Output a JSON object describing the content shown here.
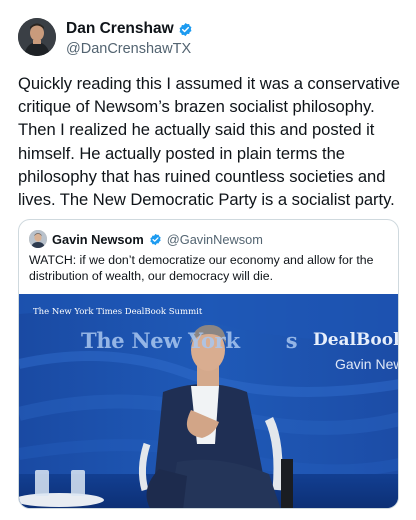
{
  "author": {
    "name": "Dan Crenshaw",
    "handle": "@DanCrenshawTX",
    "verified": true
  },
  "tweet": {
    "text": "Quickly reading this I assumed it was a conservative critique of Newsom’s brazen socialist philosophy. Then I realized he actually said this and posted it himself. He actually posted in plain terms the philosophy that has ruined countless societies and lives. The New Democratic Party is a socialist party."
  },
  "quote": {
    "author_name": "Gavin Newsom",
    "author_handle": "@GavinNewsom",
    "verified": true,
    "text": "WATCH: if we don’t democratize our economy and allow for the distribution of wealth, our democracy will die.",
    "media": {
      "banner_text": "The New York Times DealBook Summit",
      "logo_text": "The New York",
      "logo_tail": "s",
      "event_text": "DealBook S",
      "speaker_label": "Gavin New"
    }
  },
  "icons": {
    "verified": "verified-badge-icon"
  },
  "colors": {
    "verified_blue": "#1d9bf0",
    "text_primary": "#0f1419",
    "text_secondary": "#536471",
    "border": "#cfd9de",
    "stage_blue": "#1b4fa8"
  }
}
